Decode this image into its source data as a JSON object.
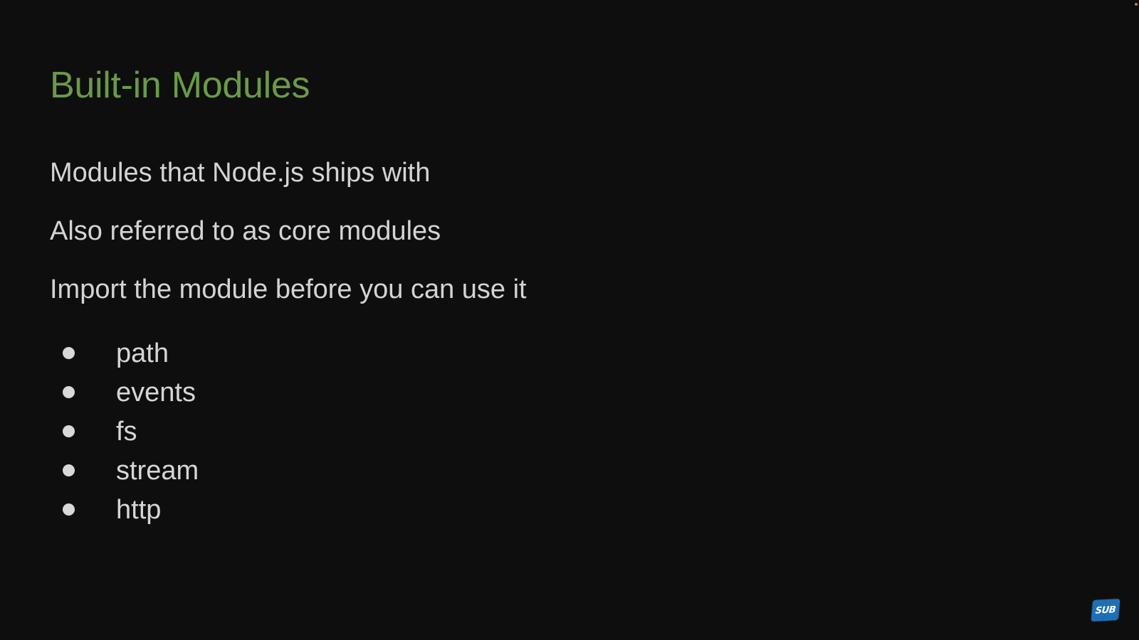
{
  "slide": {
    "title": "Built-in Modules",
    "paragraphs": [
      "Modules that Node.js ships with",
      "Also referred to as core modules",
      "Import the module before you can use it"
    ],
    "bullets": [
      "path",
      "events",
      "fs",
      "stream",
      "http"
    ]
  },
  "badge": {
    "label": "SUB"
  },
  "colors": {
    "title": "#6a9a48",
    "background": "#0e0e0e",
    "text": "#d6d6d6",
    "badge": "#1f6fb5",
    "corner_dot": "#e0702a"
  }
}
